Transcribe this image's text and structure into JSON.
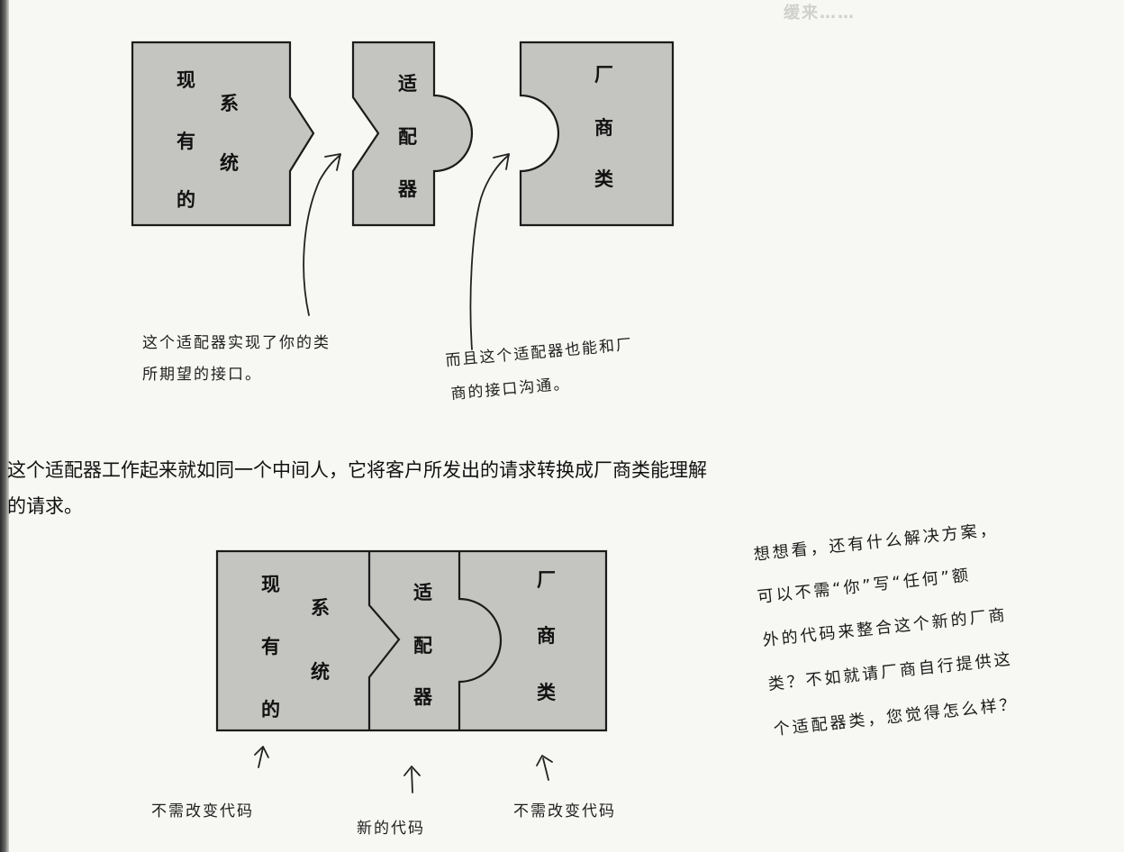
{
  "bleed_text": "缓来……",
  "diagram1": {
    "pieces": {
      "existing": [
        "现",
        "系",
        "有",
        "统",
        "的"
      ],
      "adapter": [
        "适",
        "配",
        "器"
      ],
      "vendor": [
        "厂",
        "商",
        "类"
      ]
    },
    "caption_left": [
      "这个适配器实现了你的类",
      "所期望的接口。"
    ],
    "caption_right": [
      "而且这个适配器也能和厂",
      "商的接口沟通。"
    ]
  },
  "paragraph": [
    "这个适配器工作起来就如同一个中间人，它将客户所发出的请求转换成厂商类能理解",
    "的请求。"
  ],
  "diagram2": {
    "pieces": {
      "existing": [
        "现",
        "系",
        "有",
        "统",
        "的"
      ],
      "adapter": [
        "适",
        "配",
        "器"
      ],
      "vendor": [
        "厂",
        "商",
        "类"
      ]
    },
    "label_existing": "不需改变代码",
    "label_adapter": "新的代码",
    "label_vendor": "不需改变代码"
  },
  "side_note": [
    "想想看，还有什么解决方案，",
    "可以不需“你”写“任何”额",
    "外的代码来整合这个新的厂商",
    "类？不如就请厂商自行提供这",
    "个适配器类，您觉得怎么样？"
  ],
  "colors": {
    "piece_fill": "#c4c4c0",
    "ink": "#1b1b1b",
    "page": "#f7f7f3"
  }
}
